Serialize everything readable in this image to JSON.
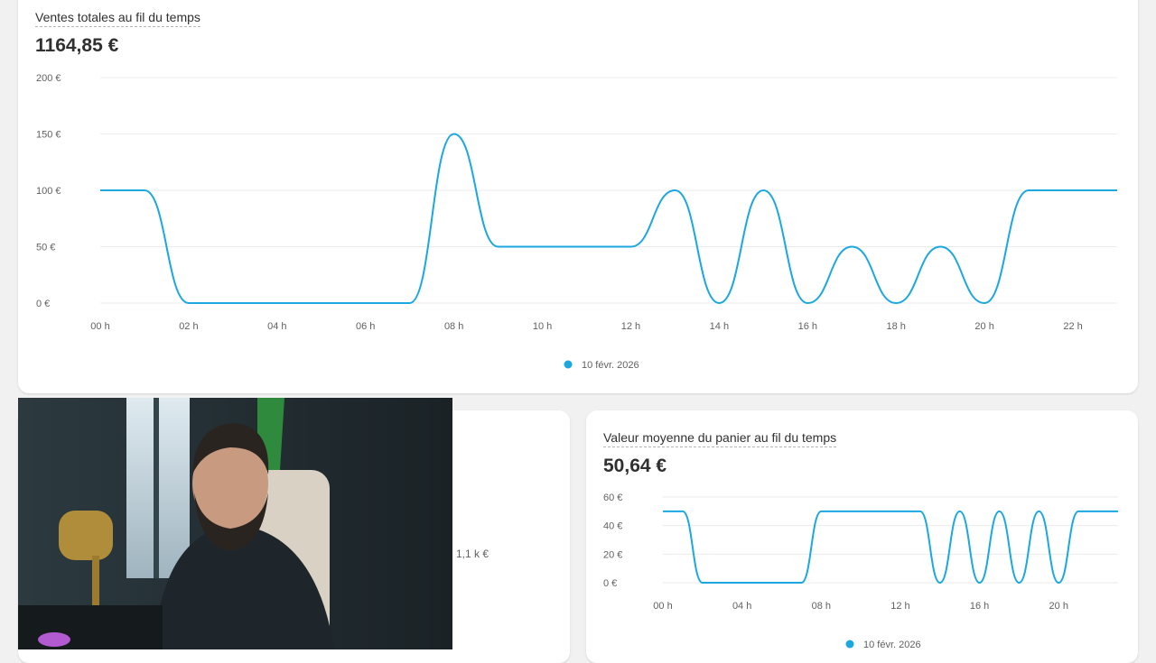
{
  "top_card": {
    "title": "Ventes totales au fil du temps",
    "total": "1164,85 €",
    "legend": "10 févr. 2026",
    "series_color": "#1ba7e0"
  },
  "bottom_right_card": {
    "title": "Valeur moyenne du panier au fil du temps",
    "total": "50,64 €",
    "legend": "10 févr. 2026",
    "series_color": "#1ba7e0"
  },
  "bottom_left_card": {
    "axis_label": "1,1 k €"
  },
  "webcam": {
    "icon": "person-webcam-feed"
  },
  "chart_data": [
    {
      "type": "line",
      "yticks": [
        "200 €",
        "150 €",
        "100 €",
        "50 €",
        "0 €"
      ],
      "ylim": [
        0,
        200
      ],
      "xticks": [
        "00 h",
        "02 h",
        "04 h",
        "06 h",
        "08 h",
        "10 h",
        "12 h",
        "14 h",
        "16 h",
        "18 h",
        "20 h",
        "22 h"
      ],
      "x": [
        0,
        1,
        2,
        3,
        4,
        5,
        6,
        7,
        8,
        9,
        10,
        11,
        12,
        13,
        14,
        15,
        16,
        17,
        18,
        19,
        20,
        21,
        22,
        23
      ],
      "series": [
        {
          "values": [
            100,
            100,
            0,
            0,
            0,
            0,
            0,
            0,
            150,
            50,
            50,
            50,
            50,
            100,
            0,
            100,
            0,
            50,
            0,
            50,
            0,
            100,
            100,
            100
          ]
        }
      ],
      "grid": true
    },
    {
      "type": "line",
      "yticks": [
        "60 €",
        "40 €",
        "20 €",
        "0 €"
      ],
      "ylim": [
        0,
        60
      ],
      "xticks": [
        "00 h",
        "04 h",
        "08 h",
        "12 h",
        "16 h",
        "20 h"
      ],
      "x": [
        0,
        1,
        2,
        3,
        4,
        5,
        6,
        7,
        8,
        9,
        10,
        11,
        12,
        13,
        14,
        15,
        16,
        17,
        18,
        19,
        20,
        21,
        22,
        23
      ],
      "series": [
        {
          "values": [
            50,
            50,
            0,
            0,
            0,
            0,
            0,
            0,
            50,
            50,
            50,
            50,
            50,
            50,
            0,
            50,
            0,
            50,
            0,
            50,
            0,
            50,
            50,
            50
          ]
        }
      ],
      "grid": true
    }
  ]
}
